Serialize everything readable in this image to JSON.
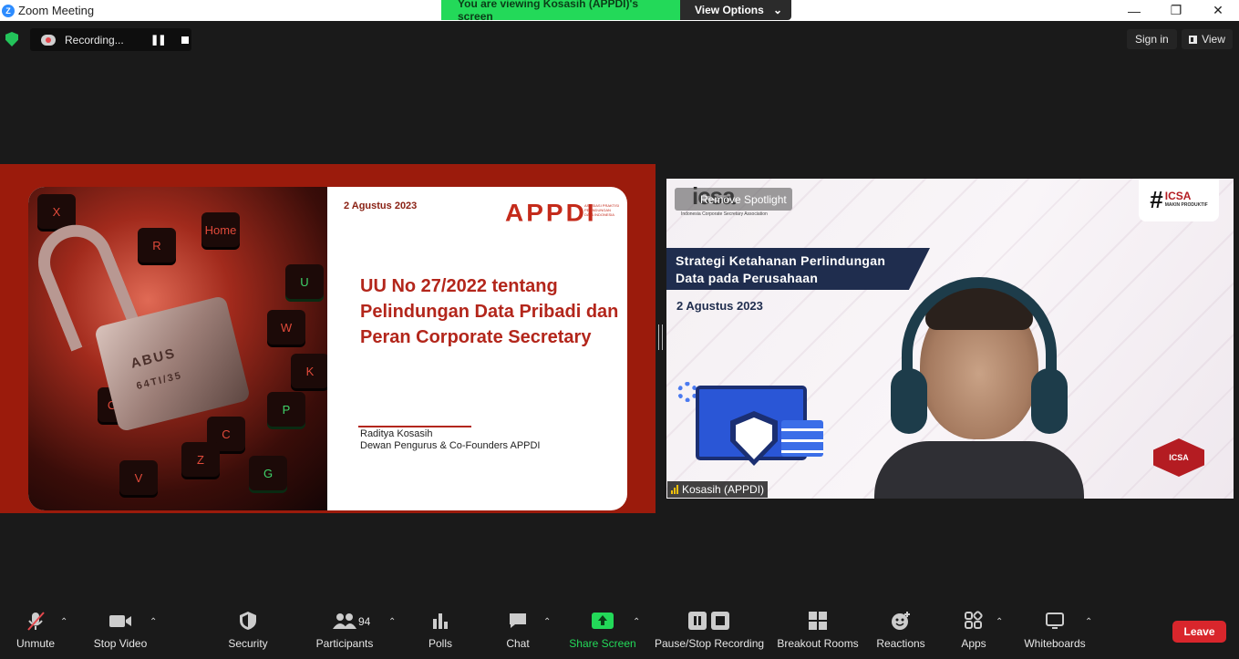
{
  "window": {
    "title": "Zoom Meeting",
    "controls": {
      "minimize": "—",
      "maximize": "❐",
      "close": "✕"
    }
  },
  "banner": {
    "viewing_text": "You are viewing Kosasih (APPDI)'s screen",
    "view_options": "View Options"
  },
  "recording": {
    "label": "Recording...",
    "pause": "❚❚"
  },
  "top_right": {
    "sign_in": "Sign in",
    "view": "View"
  },
  "slide": {
    "date": "2 Agustus 2023",
    "logo": "APPDI",
    "logo_tagline": "ASOSIASI PRAKTISI PELINDUNGAN DATA INDONESIA",
    "title": "UU No 27/2022 tentang Pelindungan Data Pribadi dan Peran Corporate Secretary",
    "author_name": "Raditya Kosasih",
    "author_role": "Dewan Pengurus & Co-Founders APPDI",
    "lock_text": "ABUS",
    "lock_code": "64TI/35",
    "keys": [
      "Home",
      "R",
      "Ctrl",
      "W",
      "K",
      "P",
      "C",
      "Z",
      "G",
      "X",
      "U",
      "V"
    ]
  },
  "video": {
    "logo": "icsa",
    "logo_sub": "Indonesia Corporate Secretary Association",
    "spotlight_button": "Remove Spotlight",
    "hashtag": "ICSA",
    "hashtag_sub": "MAKIN PRODUKTIF",
    "banner_line1": "Strategi Ketahanan Perlindungan",
    "banner_line2": "Data pada Perusahaan",
    "date": "2 Agustus 2023",
    "badge": "ICSA",
    "participant_name": "Kosasih (APPDI)"
  },
  "toolbar": {
    "unmute": "Unmute",
    "stop_video": "Stop Video",
    "security": "Security",
    "participants": "Participants",
    "participants_count": "94",
    "polls": "Polls",
    "chat": "Chat",
    "share_screen": "Share Screen",
    "pause_stop_recording": "Pause/Stop Recording",
    "breakout_rooms": "Breakout Rooms",
    "reactions": "Reactions",
    "apps": "Apps",
    "whiteboards": "Whiteboards",
    "leave": "Leave",
    "caret": "⌃"
  },
  "colors": {
    "share_green": "#23d959",
    "leave_red": "#d9262c",
    "slide_red": "#9b1b0c"
  }
}
